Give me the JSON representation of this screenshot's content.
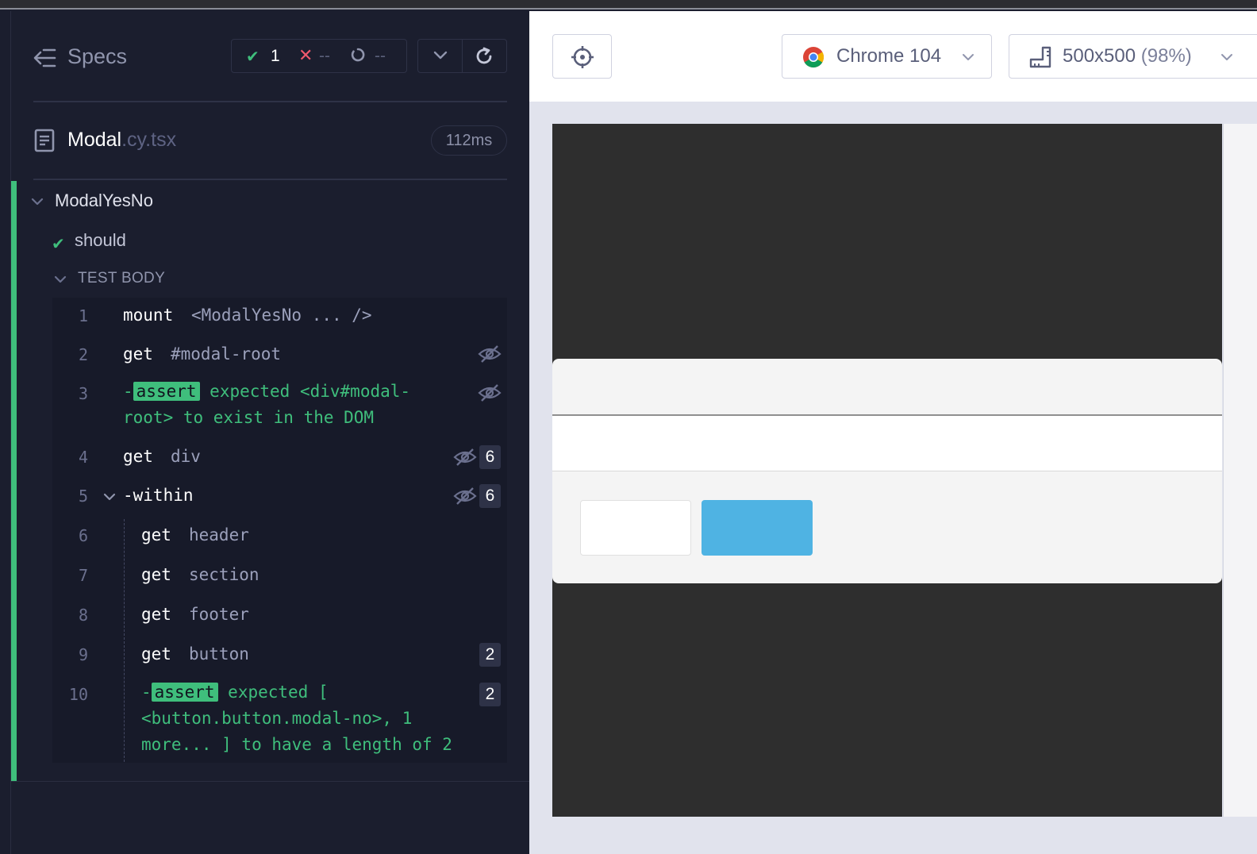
{
  "reporter": {
    "specs_label": "Specs",
    "stats": {
      "passed": "1",
      "failed": "--",
      "pending": "--"
    },
    "file": {
      "base": "Modal",
      "ext": ".cy.tsx",
      "duration": "112ms"
    },
    "suite": {
      "name": "ModalYesNo"
    },
    "test": {
      "name": "should",
      "body_label": "TEST BODY"
    },
    "commands": [
      {
        "num": "1",
        "name": "mount",
        "message": "<ModalYesNo ... />"
      },
      {
        "num": "2",
        "name": "get",
        "message": "#modal-root"
      },
      {
        "num": "3",
        "name": "assert",
        "message_line1": "expected <div#modal-",
        "message_line2": "root> to exist in the DOM"
      },
      {
        "num": "4",
        "name": "get",
        "message": "div",
        "count": "6"
      },
      {
        "num": "5",
        "name": "-within",
        "count": "6"
      },
      {
        "num": "6",
        "name": "get",
        "message": "header"
      },
      {
        "num": "7",
        "name": "get",
        "message": "section"
      },
      {
        "num": "8",
        "name": "get",
        "message": "footer"
      },
      {
        "num": "9",
        "name": "get",
        "message": "button",
        "count": "2"
      },
      {
        "num": "10",
        "name": "assert",
        "message_line1": "expected [",
        "message_line2": "<button.button.modal-no>, 1",
        "message_line3": "more... ] to have a length of 2",
        "count": "2"
      }
    ]
  },
  "toolbar": {
    "browser": "Chrome 104",
    "viewport": "500x500",
    "zoom": "(98%)"
  },
  "colors": {
    "pass": "#3fbe7c",
    "fail": "#f1596d",
    "reporter_bg": "#1b1e2e",
    "modal_yes_button": "#4fb3e3"
  }
}
